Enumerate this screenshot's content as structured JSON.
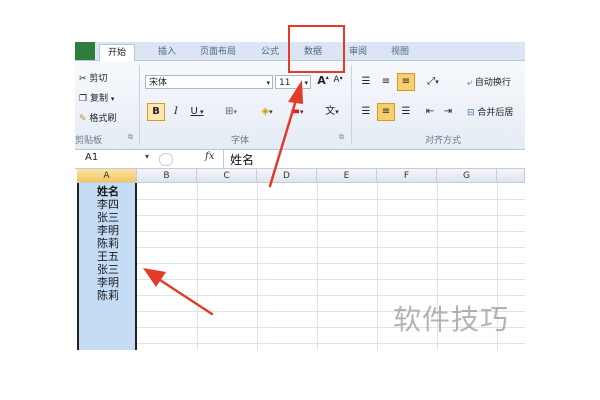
{
  "tabs": [
    {
      "label": "",
      "active": false,
      "kind": "file"
    },
    {
      "label": "开始",
      "active": true
    },
    {
      "label": "插入",
      "active": false
    },
    {
      "label": "页面布局",
      "active": false
    },
    {
      "label": "公式",
      "active": false
    },
    {
      "label": "数据",
      "active": false,
      "highlighted": true
    },
    {
      "label": "审阅",
      "active": false
    },
    {
      "label": "视图",
      "active": false
    }
  ],
  "clipboard": {
    "cut": "剪切",
    "copy": "复制",
    "format_painter": "格式刷",
    "group": "剪贴板"
  },
  "font": {
    "name": "宋体",
    "size": "11",
    "grow": "A",
    "shrink": "A",
    "bold": "B",
    "italic": "I",
    "underline": "U",
    "group": "字体"
  },
  "alignment": {
    "wrap": "自动换行",
    "merge": "合并后居",
    "group": "对齐方式"
  },
  "formula_bar": {
    "name_box": "A1",
    "fx": "fx",
    "content": "姓名"
  },
  "columns": [
    "A",
    "B",
    "C",
    "D",
    "E",
    "F",
    "G"
  ],
  "cells": [
    "姓名",
    "李四",
    "张三",
    "李明",
    "陈莉",
    "王五",
    "张三",
    "李明",
    "陈莉"
  ],
  "colors": {
    "accent": "#f8cf6a",
    "selection": "#c4dcf4",
    "arrow": "#e23b2c",
    "highlight_box": "#e23b2c"
  },
  "watermark": "软件技巧"
}
